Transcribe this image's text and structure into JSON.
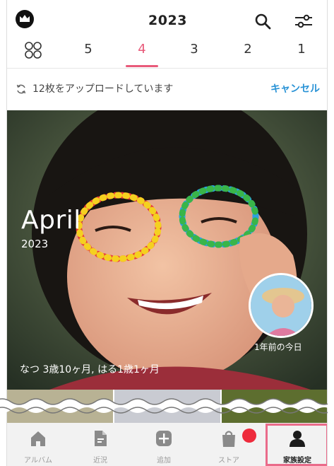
{
  "header": {
    "year": "2023",
    "icons": {
      "left": "crown-icon",
      "search": "search-icon",
      "filter": "sliders-icon"
    }
  },
  "tabs": {
    "grid_icon": "grid-icon",
    "items": [
      {
        "label": "5",
        "active": false
      },
      {
        "label": "4",
        "active": true
      },
      {
        "label": "3",
        "active": false
      },
      {
        "label": "2",
        "active": false
      },
      {
        "label": "1",
        "active": false
      }
    ]
  },
  "upload": {
    "status": "12枚をアップロードしています",
    "cancel": "キャンセル"
  },
  "hero": {
    "month": "April",
    "year": "2023",
    "memory_label": "1年前の今日",
    "ages": "なつ 3歳10ヶ月, はる1歳1ヶ月"
  },
  "nav": {
    "items": [
      {
        "label": "アルバム",
        "icon": "home-icon"
      },
      {
        "label": "近況",
        "icon": "document-icon"
      },
      {
        "label": "追加",
        "icon": "add-icon"
      },
      {
        "label": "ストア",
        "icon": "shopping-bag-icon"
      },
      {
        "label": "家族設定",
        "icon": "person-icon"
      }
    ]
  },
  "colors": {
    "accent_pink": "#e85a7a",
    "link_blue": "#2a93d6",
    "badge_red": "#ee2b3c",
    "highlight": "#ea6b8a"
  }
}
